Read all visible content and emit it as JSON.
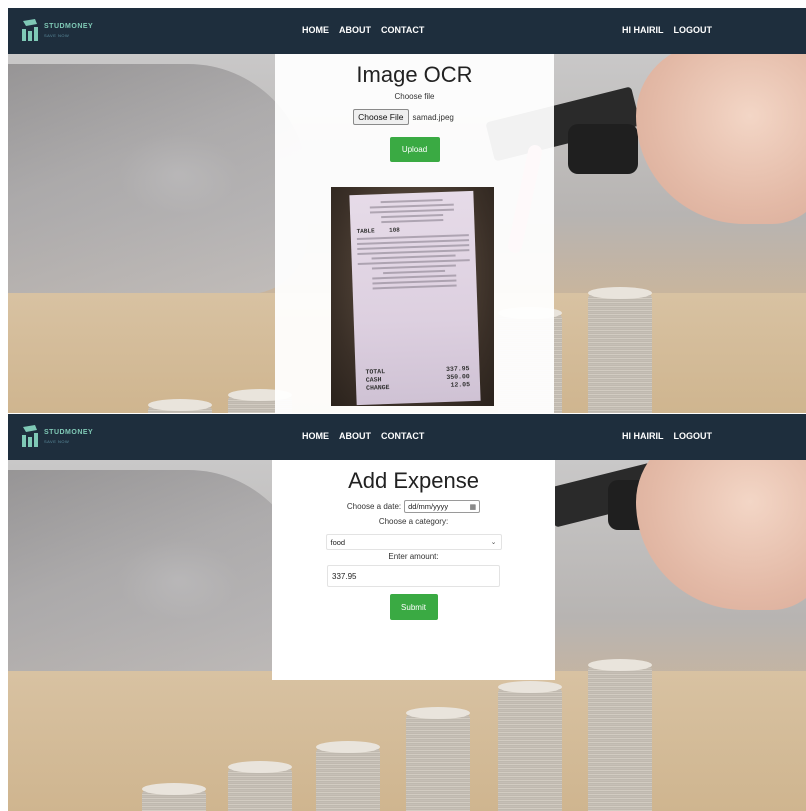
{
  "brand": {
    "name": "STUDMONEY",
    "tagline": "SAVE NOW"
  },
  "nav": {
    "links": [
      "HOME",
      "ABOUT",
      "CONTACT"
    ],
    "greeting": "HI HAIRIL",
    "logout": "LOGOUT"
  },
  "ocr": {
    "title": "Image OCR",
    "choose_label": "Choose file",
    "choose_button": "Choose File",
    "file_name": "samad.jpeg",
    "upload_button": "Upload",
    "receipt": {
      "table_label": "TABLE",
      "table_no": "108",
      "totals": [
        {
          "label": "TOTAL",
          "value": "337.95"
        },
        {
          "label": "CASH",
          "value": "350.00"
        },
        {
          "label": "CHANGE",
          "value": "12.05"
        }
      ]
    }
  },
  "expense": {
    "title": "Add Expense",
    "date_label": "Choose a date:",
    "date_placeholder": "dd/mm/yyyy",
    "category_label": "Choose a category:",
    "category_value": "food",
    "amount_label": "Enter amount:",
    "amount_value": "337.95",
    "submit_button": "Submit"
  },
  "colors": {
    "navbar": "#1e2e3d",
    "button_green": "#3aaa43"
  },
  "icons": [
    "logo-icon",
    "calendar-icon",
    "chevron-down-icon"
  ]
}
